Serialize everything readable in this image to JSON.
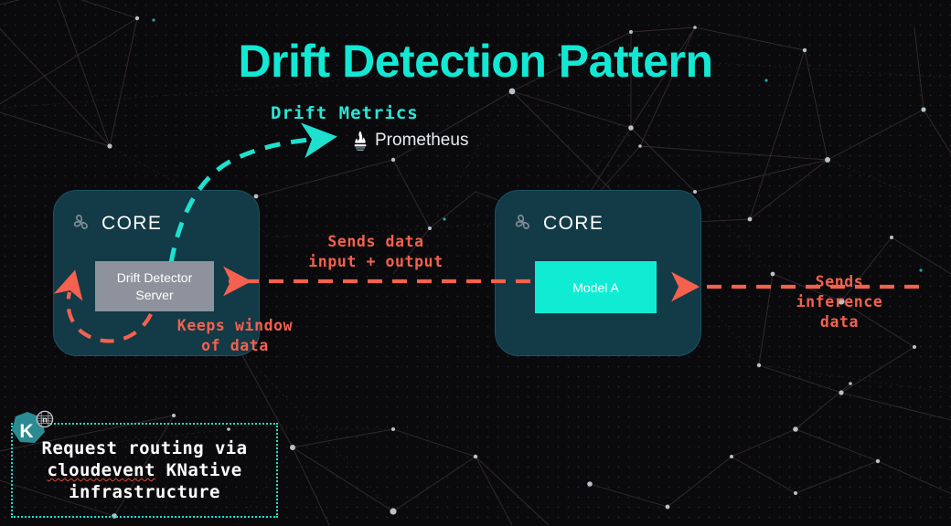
{
  "slide": {
    "title": "Drift Detection Pattern",
    "background_color": "#0a0a0c",
    "accent_color": "#12e8d4",
    "arrow_color": "#f4614e"
  },
  "metrics": {
    "label": "Drift Metrics",
    "target_name": "Prometheus",
    "target_icon": "prometheus-torch-icon"
  },
  "core_left": {
    "label": "CORE",
    "icon": "seldon-core-icon",
    "inner_box": {
      "label": "Drift Detector\nServer",
      "fill": "#8d929d"
    }
  },
  "core_right": {
    "label": "CORE",
    "icon": "seldon-core-icon",
    "inner_box": {
      "label": "Model A",
      "fill": "#10ecd3"
    }
  },
  "connectors": {
    "drift_metrics_arrow": "Drift Metrics",
    "sends_data": "Sends data\ninput + output",
    "sends_inference": "Sends\ninference\ndata",
    "keeps_window": "Keeps window\nof data"
  },
  "callout": {
    "logo_letter": "K",
    "logo_name": "knative-logo",
    "line1": "Request routing via",
    "line2_misspelled": "cloudevent",
    "line2_rest": " KNative",
    "line3": "infrastructure",
    "border_color": "#1ee0cf"
  }
}
